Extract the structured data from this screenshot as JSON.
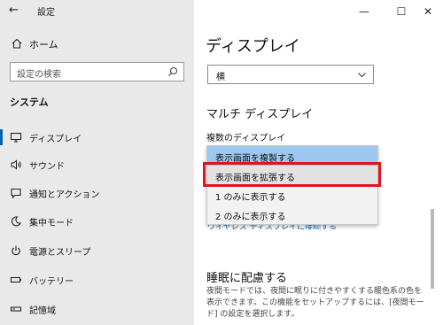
{
  "window": {
    "title": "設定",
    "controls": {
      "minimize": "—",
      "maximize": "☐",
      "close": "✕"
    }
  },
  "sidebar": {
    "home_label": "ホーム",
    "search_placeholder": "設定の検索",
    "section_title": "システム",
    "items": [
      {
        "label": "ディスプレイ",
        "icon": "monitor-icon",
        "active": true
      },
      {
        "label": "サウンド",
        "icon": "speaker-icon"
      },
      {
        "label": "通知とアクション",
        "icon": "notification-icon"
      },
      {
        "label": "集中モード",
        "icon": "moon-icon"
      },
      {
        "label": "電源とスリープ",
        "icon": "power-icon"
      },
      {
        "label": "バッテリー",
        "icon": "battery-icon"
      },
      {
        "label": "記憶域",
        "icon": "storage-icon"
      }
    ]
  },
  "main": {
    "heading": "ディスプレイ",
    "orientation_value": "横",
    "multi_display_heading": "マルチ ディスプレイ",
    "multi_display_label": "複数のディスプレイ",
    "dropdown_options": [
      "表示画面を複製する",
      "表示画面を拡張する",
      "1 のみに表示する",
      "2 のみに表示する"
    ],
    "partial_link": "ワイヤレス ディスプレイに接続する",
    "night_heading": "睡眠に配慮する",
    "night_description": "夜間モードでは、夜間に眠りに付きやすくする暖色系の色を表示できます。この機能をセットアップするには、[夜間モード] の設定を選択します。"
  },
  "colors": {
    "accent": "#0063b1",
    "selected_option": "#9cc8ef",
    "highlight": "#e0141e"
  }
}
